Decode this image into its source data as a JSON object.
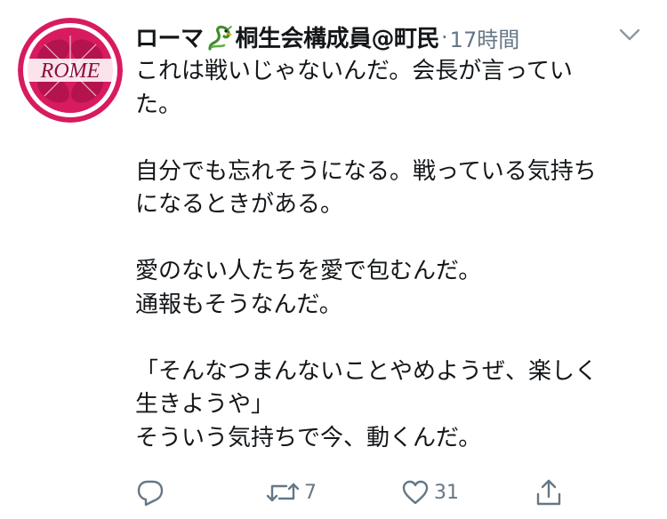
{
  "tweet": {
    "avatar_text": "ROME",
    "display_name_before_emoji": "ローマ",
    "display_name_after_emoji": "桐生会構成員@町民",
    "name_emoji": "dragon-icon",
    "separator": "·",
    "timestamp": "17時間",
    "body_lines": [
      "これは戦いじゃないんだ。会長が言ってい",
      "た。",
      "",
      "自分でも忘れそうになる。戦っている気持ち",
      "になるときがある。",
      "",
      "愛のない人たちを愛で包むんだ。",
      "通報もそうなんだ。",
      "",
      "「そんなつまんないことやめようぜ、楽しく",
      "生きようや」",
      "そういう気持ちで今、動くんだ。"
    ],
    "actions": {
      "reply_icon": "reply-icon",
      "retweet_icon": "retweet-icon",
      "retweet_count": "7",
      "like_icon": "heart-icon",
      "like_count": "31",
      "share_icon": "share-icon"
    },
    "menu_icon": "chevron-down-icon"
  },
  "colors": {
    "text": "#14171a",
    "secondary": "#657786",
    "avatar_ring": "#d81b60",
    "avatar_fill": "#d81b60"
  }
}
